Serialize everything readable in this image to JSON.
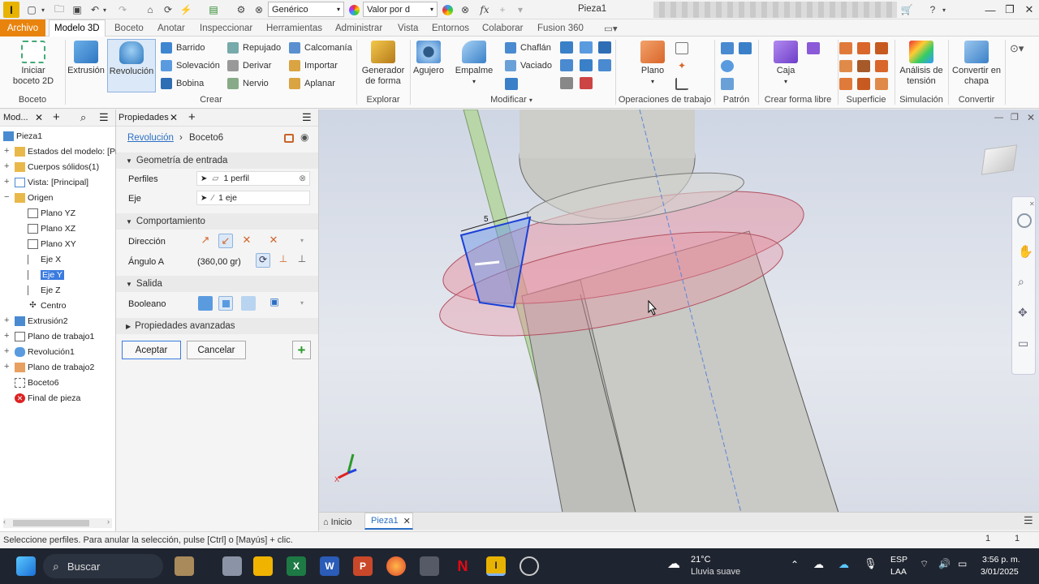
{
  "titlebar": {
    "material": "Genérico",
    "appearance": "Valor por d",
    "doc_title": "Pieza1"
  },
  "tabs": [
    "Archivo",
    "Modelo 3D",
    "Boceto",
    "Anotar",
    "Inspeccionar",
    "Herramientas",
    "Administrar",
    "Vista",
    "Entornos",
    "Colaborar",
    "Fusion 360"
  ],
  "ribbon": {
    "boceto": {
      "start": "Iniciar boceto 2D",
      "label": "Boceto"
    },
    "crear": {
      "extrusion": "Extrusión",
      "revolucion": "Revolución",
      "barrido": "Barrido",
      "solevacion": "Solevación",
      "bobina": "Bobina",
      "repujado": "Repujado",
      "derivar": "Derivar",
      "nervio": "Nervio",
      "calcomania": "Calcomanía",
      "importar": "Importar",
      "aplanar": "Aplanar",
      "label": "Crear"
    },
    "explorar": {
      "generador": "Generador de forma",
      "label": "Explorar"
    },
    "modificar": {
      "agujero": "Agujero",
      "empalme": "Empalme",
      "chaflan": "Chaflán",
      "vaciado": "Vaciado",
      "label": "Modificar"
    },
    "operaciones": {
      "plano": "Plano",
      "label": "Operaciones de trabajo"
    },
    "patron": {
      "label": "Patrón"
    },
    "forma_libre": {
      "caja": "Caja",
      "label": "Crear forma libre"
    },
    "superficie": {
      "label": "Superficie"
    },
    "simulacion": {
      "analisis": "Análisis de tensión",
      "label": "Simulación"
    },
    "convertir": {
      "chapa": "Convertir en chapa",
      "label": "Convertir"
    }
  },
  "browser": {
    "tab": "Mod...",
    "items": [
      {
        "label": "Pieza1"
      },
      {
        "label": "Estados del modelo: [Pri"
      },
      {
        "label": "Cuerpos sólidos(1)"
      },
      {
        "label": "Vista: [Principal]"
      },
      {
        "label": "Origen"
      },
      {
        "label": "Plano YZ"
      },
      {
        "label": "Plano XZ"
      },
      {
        "label": "Plano XY"
      },
      {
        "label": "Eje X"
      },
      {
        "label": "Eje Y"
      },
      {
        "label": "Eje Z"
      },
      {
        "label": "Centro"
      },
      {
        "label": "Extrusión2"
      },
      {
        "label": "Plano de trabajo1"
      },
      {
        "label": "Revolución1"
      },
      {
        "label": "Plano de trabajo2"
      },
      {
        "label": "Boceto6"
      },
      {
        "label": "Final de pieza"
      }
    ]
  },
  "props": {
    "tab": "Propiedades",
    "crumb_feature": "Revolución",
    "crumb_sketch": "Boceto6",
    "section_input": "Geometría de entrada",
    "perfiles_label": "Perfiles",
    "perfiles_value": "1 perfil",
    "eje_label": "Eje",
    "eje_value": "1 eje",
    "section_behavior": "Comportamiento",
    "direccion_label": "Dirección",
    "angulo_label": "Ángulo A",
    "angulo_value": "(360,00 gr)",
    "section_output": "Salida",
    "booleano_label": "Booleano",
    "section_advanced": "Propiedades avanzadas",
    "accept": "Aceptar",
    "cancel": "Cancelar"
  },
  "viewport": {
    "dimension": "5"
  },
  "doctabs": {
    "home": "Inicio",
    "doc": "Pieza1"
  },
  "status": {
    "message": "Seleccione perfiles. Para anular la selección, pulse [Ctrl] o [Mayús] + clic.",
    "n1": "1",
    "n2": "1"
  },
  "taskbar": {
    "search": "Buscar",
    "weather_temp": "21°C",
    "weather_desc": "Lluvia suave",
    "lang1": "ESP",
    "lang2": "LAA",
    "time": "3:56 p. m.",
    "date": "3/01/2025"
  },
  "colors": {
    "accent_orange": "#e8830d",
    "selection_blue": "#1a3fd6",
    "preview_pink": "#e88a9a"
  }
}
